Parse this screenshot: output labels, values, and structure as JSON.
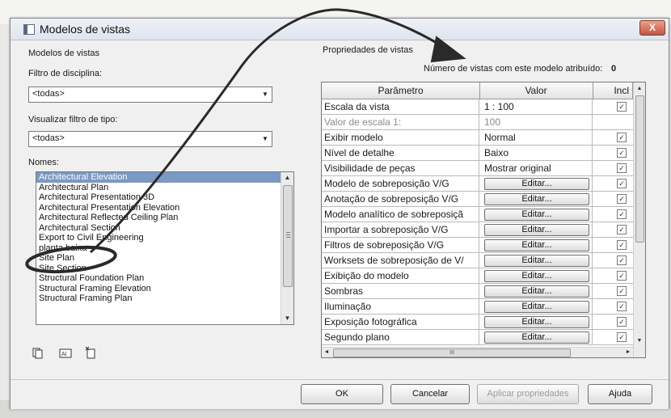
{
  "dialog": {
    "title": "Modelos de vistas",
    "close_label": "X"
  },
  "left": {
    "section_title": "Modelos de vistas",
    "discipline_label": "Filtro de disciplina:",
    "discipline_value": "<todas>",
    "type_label": "Visualizar filtro de tipo:",
    "type_value": "<todas>",
    "names_label": "Nomes:",
    "names": [
      "Architectural Elevation",
      "Architectural Plan",
      "Architectural Presentation 3D",
      "Architectural Presentation Elevation",
      "Architectural Reflected Ceiling Plan",
      "Architectural Section",
      "Export to Civil Engineering",
      "planta baixa",
      "Site Plan",
      "Site Section",
      "Structural Foundation Plan",
      "Structural Framing Elevation",
      "Structural Framing Plan"
    ],
    "selected_index": 0
  },
  "right": {
    "section_title": "Propriedades de vistas",
    "count_label": "Número de vistas com este modelo atribuído:",
    "count_value": "0",
    "headers": {
      "param": "Parâmetro",
      "value": "Valor",
      "incl": "Incl"
    },
    "rows": [
      {
        "param": "Escala da vista",
        "value": "1 : 100",
        "type": "text",
        "checked": true
      },
      {
        "param": "Valor de escala   1:",
        "value": "100",
        "type": "text",
        "checked": null,
        "grey": true
      },
      {
        "param": "Exibir modelo",
        "value": "Normal",
        "type": "text",
        "checked": true
      },
      {
        "param": "Nível de detalhe",
        "value": "Baixo",
        "type": "text",
        "checked": true
      },
      {
        "param": "Visibilidade de peças",
        "value": "Mostrar original",
        "type": "text",
        "checked": true
      },
      {
        "param": "Modelo de sobreposição V/G",
        "value": "Editar...",
        "type": "button",
        "checked": true
      },
      {
        "param": "Anotação de sobreposição V/G",
        "value": "Editar...",
        "type": "button",
        "checked": true
      },
      {
        "param": "Modelo analítico de sobreposiçã",
        "value": "Editar...",
        "type": "button",
        "checked": true
      },
      {
        "param": "Importar a sobreposição V/G",
        "value": "Editar...",
        "type": "button",
        "checked": true
      },
      {
        "param": "Filtros de sobreposição V/G",
        "value": "Editar...",
        "type": "button",
        "checked": true
      },
      {
        "param": "Worksets de sobreposição de V/",
        "value": "Editar...",
        "type": "button",
        "checked": true
      },
      {
        "param": "Exibição do modelo",
        "value": "Editar...",
        "type": "button",
        "checked": true
      },
      {
        "param": "Sombras",
        "value": "Editar...",
        "type": "button",
        "checked": true
      },
      {
        "param": "Iluminação",
        "value": "Editar...",
        "type": "button",
        "checked": true
      },
      {
        "param": "Exposição fotográfica",
        "value": "Editar...",
        "type": "button",
        "checked": true
      },
      {
        "param": "Segundo plano",
        "value": "Editar...",
        "type": "button",
        "checked": true
      }
    ],
    "hscroll_grip": "III"
  },
  "buttons": {
    "ok": "OK",
    "cancel": "Cancelar",
    "apply": "Aplicar propriedades",
    "help": "Ajuda"
  },
  "icons": {
    "duplicate": "duplicate-icon",
    "rename": "rename-icon",
    "delete": "delete-icon"
  }
}
